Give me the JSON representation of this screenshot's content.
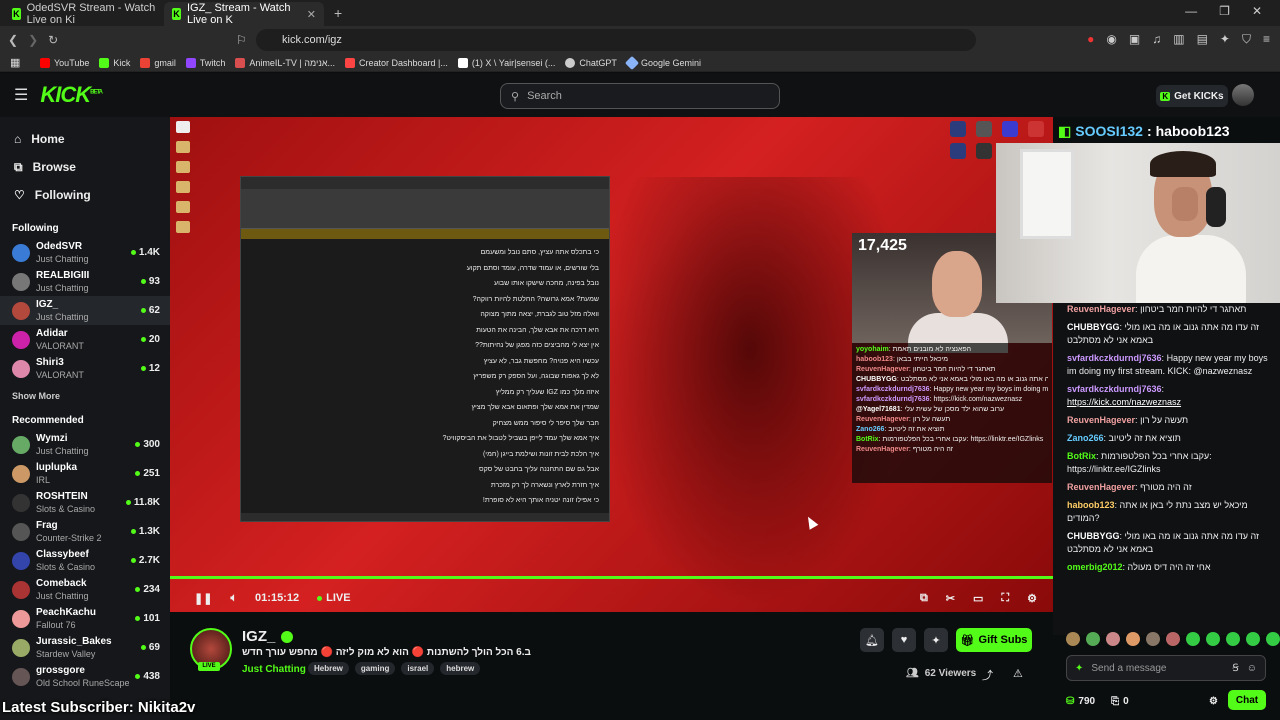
{
  "browser": {
    "tabs": [
      {
        "label": "OdedSVR Stream - Watch Live on Ki",
        "active": false
      },
      {
        "label": "IGZ_ Stream - Watch Live on K",
        "active": true
      }
    ],
    "url": "kick.com/igz",
    "bookmarks": [
      {
        "label": "YouTube",
        "color": "#ff0000"
      },
      {
        "label": "Kick",
        "color": "#53fc18"
      },
      {
        "label": "gmail",
        "color": "#ea4335"
      },
      {
        "label": "Twitch",
        "color": "#9146ff"
      },
      {
        "label": "AnimeIL-TV | אנימה...",
        "color": "#d94f4f"
      },
      {
        "label": "Creator Dashboard |...",
        "color": "#ff4444"
      },
      {
        "label": "(1) X \\ Yair|sensei (...",
        "color": "#ffffff"
      },
      {
        "label": "ChatGPT",
        "color": "#cccccc"
      },
      {
        "label": "Google Gemini",
        "color": "#8ab4f8"
      }
    ]
  },
  "header": {
    "search_placeholder": "Search",
    "get_kicks": "Get KICKs"
  },
  "sidebar": {
    "nav": {
      "home": "Home",
      "browse": "Browse",
      "following": "Following"
    },
    "following_title": "Following",
    "following": [
      {
        "name": "OdedSVR",
        "category": "Just Chatting",
        "viewers": "1.4K",
        "color": "#3a7bd5"
      },
      {
        "name": "REALBIGIII",
        "category": "Just Chatting",
        "viewers": "93",
        "color": "#777"
      },
      {
        "name": "IGZ_",
        "category": "Just Chatting",
        "viewers": "62",
        "color": "#b3483c"
      },
      {
        "name": "Adidar",
        "category": "VALORANT",
        "viewers": "20",
        "color": "#c2a"
      },
      {
        "name": "Shiri3",
        "category": "VALORANT",
        "viewers": "12",
        "color": "#d8a"
      }
    ],
    "show_more": "Show More",
    "recommended_title": "Recommended",
    "recommended": [
      {
        "name": "Wymzi",
        "category": "Just Chatting",
        "viewers": "300",
        "color": "#6a6"
      },
      {
        "name": "luplupka",
        "category": "IRL",
        "viewers": "251",
        "color": "#c96"
      },
      {
        "name": "ROSHTEIN",
        "category": "Slots & Casino",
        "viewers": "11.8K",
        "color": "#333"
      },
      {
        "name": "Frag",
        "category": "Counter-Strike 2",
        "viewers": "1.3K",
        "color": "#555"
      },
      {
        "name": "Classybeef",
        "category": "Slots & Casino",
        "viewers": "2.7K",
        "color": "#34a"
      },
      {
        "name": "Comeback",
        "category": "Just Chatting",
        "viewers": "234",
        "color": "#a33"
      },
      {
        "name": "PeachKachu",
        "category": "Fallout 76",
        "viewers": "101",
        "color": "#e99"
      },
      {
        "name": "Jurassic_Bakes",
        "category": "Stardew Valley",
        "viewers": "69",
        "color": "#9a6"
      },
      {
        "name": "grossgore",
        "category": "Old School RuneScape",
        "viewers": "438",
        "color": "#655"
      }
    ]
  },
  "player": {
    "viewer_count_overlay": "17,425",
    "time": "01:15:12",
    "live_label": "LIVE",
    "doc_lines": [
      "כי בתכלס אתה עציץ, סתם נובל ומשעמם",
      "בלי שורשים, או עמוד שדרה, עומד וסתם תקוע",
      "נובל בפינה, מחכה שישקו אותו שבוע",
      "שמעת? אמא גרושה? החלטת להיות רווקה?",
      "וואלה מזל טוב לגברת, יצאה מתוך מצוקה",
      "היא דרכה את אבא שלך, הבינה את הטעות",
      "אין יצא לי מהביצים כזה מפגן של נחיתות??",
      "עכשיו היא פנויה? מחפשת גבר, לא עציץ",
      "לא לך גאפות שבוגה, ועל הספק רק משפריץ",
      "איזה מלך כמו IGZ שעליך רק ממליץ",
      "שמדין את אמא שלך ופתאום אבא שלך מציץ",
      "חבר שלך סיפר לי סיפור ממש מצחיק",
      "איך אמא שלך עמד לייפן בשביל לטבול את הביסקוויט?",
      "איך הלכת לבית זונות ושילמת בייגן (חמי)",
      "אבל גם שם התחננה עליך בחבט של סקס",
      "איך חזרת לארץ ונשארה לך רק מזכרת",
      "כי אפילו זונה יטניה אותך היא לא סופרת!"
    ],
    "overlay_chat": [
      {
        "user": "yoyohaim",
        "text": "הפאנציה לא מובנים תאמת",
        "color": "#53fc18"
      },
      {
        "user": "haboob123",
        "text": "מיכאל הייתי בבאן",
        "color": "#e88"
      },
      {
        "user": "ReuvenHagever",
        "text": "תאתגר די להיות חמר ביטחון",
        "color": "#e88"
      },
      {
        "user": "CHUBBYGG",
        "text": "זה עדו מה אתה גנוב או מה באו מולי באמא אני לא מסתלבט",
        "color": "#fff"
      },
      {
        "user": "svfardkczkdurndj7636",
        "text": "Happy new year my boys im doing my",
        "color": "#c9f"
      },
      {
        "user": "svfardkczkdurndj7636",
        "text": "https://kick.com/nazweznasz",
        "color": "#c9f"
      },
      {
        "user": "@Yagel71681",
        "text": "ערוב שהוא ילד מסכן של עשית עלי",
        "color": "#fff"
      },
      {
        "user": "ReuvenHagever",
        "text": "תעשה על רון",
        "color": "#e88"
      },
      {
        "user": "Zano266",
        "text": "תוציא את זה ליטיוב",
        "color": "#6cf"
      },
      {
        "user": "BotRix",
        "text": "עקבו אחרי בכל הפלטפורמות: https://linktr.ee/IGZlinks",
        "color": "#53fc18"
      },
      {
        "user": "ReuvenHagever",
        "text": "זה היה מטורף",
        "color": "#e88"
      }
    ]
  },
  "cam_banner": {
    "user": "SOOSI132",
    "text": "haboob123"
  },
  "chat": {
    "messages": [
      {
        "user": "ReuvenHagever",
        "text": "תאתגר די להיות חמר ביטחון",
        "color": "#f0a0a0"
      },
      {
        "user": "CHUBBYGG",
        "text": "זה עדו מה אתה גנוב או מה באו מולי באמא אני לא מסתלבט",
        "color": "#ffffff"
      },
      {
        "user": "svfardkczkdurndj7636",
        "text": "Happy new year my boys im doing my first stream. KICK: @nazweznasz",
        "color": "#cc99ff"
      },
      {
        "user": "svfardkczkdurndj7636",
        "text": "https://kick.com/nazweznasz",
        "color": "#cc99ff"
      },
      {
        "user": "ReuvenHagever",
        "text": "תעשה על רון",
        "color": "#f0a0a0"
      },
      {
        "user": "Zano266",
        "text": "תוציא את זה ליטיוב",
        "color": "#66ccff"
      },
      {
        "user": "BotRix",
        "text": "עקבו אחרי בכל הפלטפורמות: https://linktr.ee/IGZlinks",
        "color": "#53fc18"
      },
      {
        "user": "ReuvenHagever",
        "text": "זה היה מטורף",
        "color": "#f0a0a0"
      },
      {
        "user": "haboob123",
        "text": "מיכאל יש מצב נתת לי באן או אתה המודים?",
        "color": "#ffcc66"
      },
      {
        "user": "CHUBBYGG",
        "text": "זה עדו מה אתה גנוב או מה באו מולי באמא אני לא מסתלבט",
        "color": "#ffffff"
      },
      {
        "user": "omerbig2012",
        "text": "אחי זה היה דיס מעולה",
        "color": "#53fc18"
      }
    ],
    "input_placeholder": "Send a message",
    "points": "790",
    "gifts": "0",
    "chat_button": "Chat"
  },
  "stream": {
    "streamer": "IGZ_",
    "title": "ב.6 הכל הולך להשתנות 🔴 הוא לא מוק ליזה 🔴 מחפש עורך חדש",
    "category": "Just Chatting",
    "tags": [
      "Hebrew",
      "gaming",
      "israel",
      "hebrew"
    ],
    "gift_subs": "Gift Subs",
    "viewers": "62 Viewers",
    "live_badge": "LIVE"
  },
  "overlay_footer": "Latest Subscriber: Nikita2v"
}
